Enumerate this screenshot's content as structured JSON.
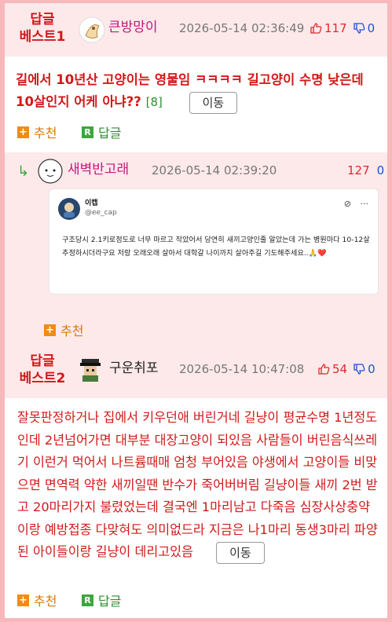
{
  "post1": {
    "best_label_line1": "답글",
    "best_label_line2": "베스트1",
    "author": "큰방망이",
    "date": "2026-05-14 02:36:49",
    "upvotes": "117",
    "downvotes": "0",
    "title": "길에서 10년산 고양이는 영물임 ㅋㅋㅋㅋ 길고양이 수명 낮은데 10살인지 어케 아냐??",
    "comment_count": "[8]",
    "move_label": "이동",
    "recommend_label": "추천",
    "reply_label": "답글"
  },
  "reply1": {
    "author": "새벽반고래",
    "date": "2026-05-14 02:39:20",
    "upvotes": "127",
    "downvotes": "0",
    "recommend_label": "추천",
    "tweet": {
      "name": "이캡",
      "handle": "@ee_cap",
      "body": "구조당시 2.1키로정도로 너무 마르고 작았어서 당연히 새끼고양인줄 알았는데 가는 병원마다 10-12살 추정하시더라구요 저랑 오래오래 살아서 대학갈 나이까지 살아주길 기도해주세요..🙏❤️",
      "more": "···"
    }
  },
  "post2": {
    "best_label_line1": "답글",
    "best_label_line2": "베스트2",
    "author": "구운취포",
    "date": "2026-05-14 10:47:08",
    "upvotes": "54",
    "downvotes": "0",
    "body": "잘못판정하거나 집에서 키우던애 버린거네 길냥이 평균수명 1년정도인데 2년넘어가면 대부분 대장고양이 되있음 사람들이 버린음식쓰레기 이런거 먹어서 나트륨때매 엄청 부어있음 야생에서 고양이들 비맞으면 면역력 약한 새끼일땐 반수가 죽어버버림 길냥이들 새끼 2번 받고 20마리가지 불렸었는데 결국엔 1마리남고 다죽음 심장사상충약이랑 예방접종 다맞혀도 의미없드라 지금은 나1마리 동생3마리 파양된 아이들이랑 길냥이 데리고있음",
    "move_label": "이동",
    "recommend_label": "추천",
    "reply_label": "답글"
  },
  "colors": {
    "accent_red": "#d21919",
    "header_bg": "#fde9ea",
    "frame_bg": "#f7b8bb",
    "recommend_orange": "#d97a00",
    "reply_green": "#2f8f2f"
  }
}
